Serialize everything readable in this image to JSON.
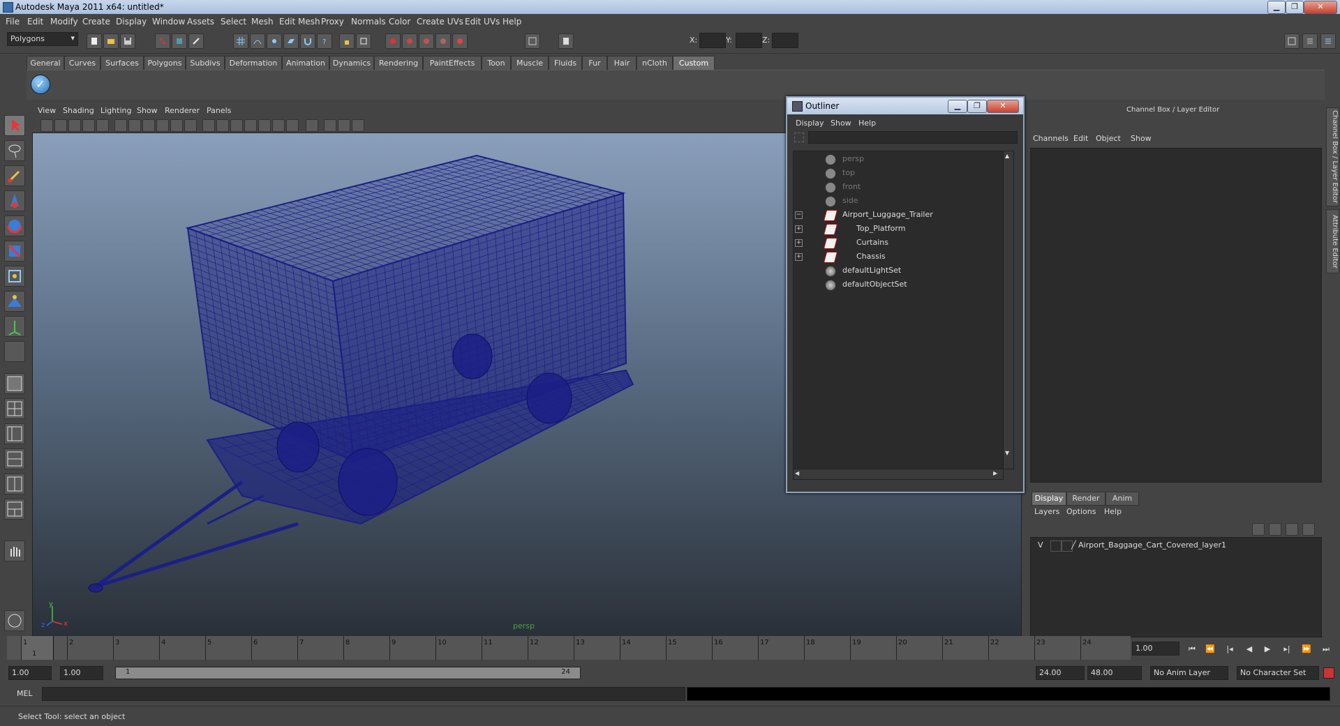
{
  "window": {
    "title": "Autodesk Maya 2011 x64: untitled*"
  },
  "menubar": [
    "File",
    "Edit",
    "Modify",
    "Create",
    "Display",
    "Window",
    "Assets",
    "Select",
    "Mesh",
    "Edit Mesh",
    "Proxy",
    "Normals",
    "Color",
    "Create UVs",
    "Edit UVs",
    "Help"
  ],
  "status_line": {
    "mode": "Polygons",
    "x_label": "X:",
    "y_label": "Y:",
    "z_label": "Z:"
  },
  "shelf_tabs": [
    "General",
    "Curves",
    "Surfaces",
    "Polygons",
    "Subdivs",
    "Deformation",
    "Animation",
    "Dynamics",
    "Rendering",
    "PaintEffects",
    "Toon",
    "Muscle",
    "Fluids",
    "Fur",
    "Hair",
    "nCloth",
    "Custom"
  ],
  "shelf_active": "Custom",
  "viewport": {
    "menu": [
      "View",
      "Shading",
      "Lighting",
      "Show",
      "Renderer",
      "Panels"
    ],
    "camera": "persp",
    "axis": {
      "x": "x",
      "y": "y",
      "z": "z"
    },
    "wire_color": "#1b1f86"
  },
  "outliner": {
    "title": "Outliner",
    "menu": [
      "Display",
      "Show",
      "Help"
    ],
    "items": [
      {
        "label": "persp",
        "type": "camera",
        "depth": 0,
        "expander": ""
      },
      {
        "label": "top",
        "type": "camera",
        "depth": 0,
        "expander": ""
      },
      {
        "label": "front",
        "type": "camera",
        "depth": 0,
        "expander": ""
      },
      {
        "label": "side",
        "type": "camera",
        "depth": 0,
        "expander": ""
      },
      {
        "label": "Airport_Luggage_Trailer",
        "type": "mesh",
        "depth": 0,
        "expander": "−"
      },
      {
        "label": "Top_Platform",
        "type": "mesh",
        "depth": 1,
        "expander": "+"
      },
      {
        "label": "Curtains",
        "type": "mesh",
        "depth": 1,
        "expander": "+"
      },
      {
        "label": "Chassis",
        "type": "mesh",
        "depth": 1,
        "expander": "+"
      },
      {
        "label": "defaultLightSet",
        "type": "set",
        "depth": 0,
        "expander": ""
      },
      {
        "label": "defaultObjectSet",
        "type": "set",
        "depth": 0,
        "expander": ""
      }
    ]
  },
  "channel_box": {
    "title": "Channel Box / Layer Editor",
    "menu": [
      "Channels",
      "Edit",
      "Object",
      "Show"
    ]
  },
  "side_tabs": [
    "Channel Box / Layer Editor",
    "Attribute Editor"
  ],
  "layer_editor": {
    "tabs": [
      "Display",
      "Render",
      "Anim"
    ],
    "active_tab": "Display",
    "menu": [
      "Layers",
      "Options",
      "Help"
    ],
    "layers": [
      {
        "visible": "V",
        "name": "Airport_Baggage_Cart_Covered_layer1"
      }
    ]
  },
  "timeline": {
    "ticks": [
      "1",
      "2",
      "3",
      "4",
      "5",
      "6",
      "7",
      "8",
      "9",
      "10",
      "11",
      "12",
      "13",
      "14",
      "15",
      "16",
      "17",
      "18",
      "19",
      "20",
      "21",
      "22",
      "23",
      "24"
    ],
    "current_marker": "1",
    "current_frame": "1.00"
  },
  "range": {
    "start": "1.00",
    "playback_start": "1.00",
    "slider_start": "1",
    "slider_end": "24",
    "playback_end": "24.00",
    "end": "48.00",
    "anim_layer": "No Anim Layer",
    "character_set": "No Character Set"
  },
  "command_line": {
    "label": "MEL"
  },
  "help_line": "Select Tool: select an object"
}
